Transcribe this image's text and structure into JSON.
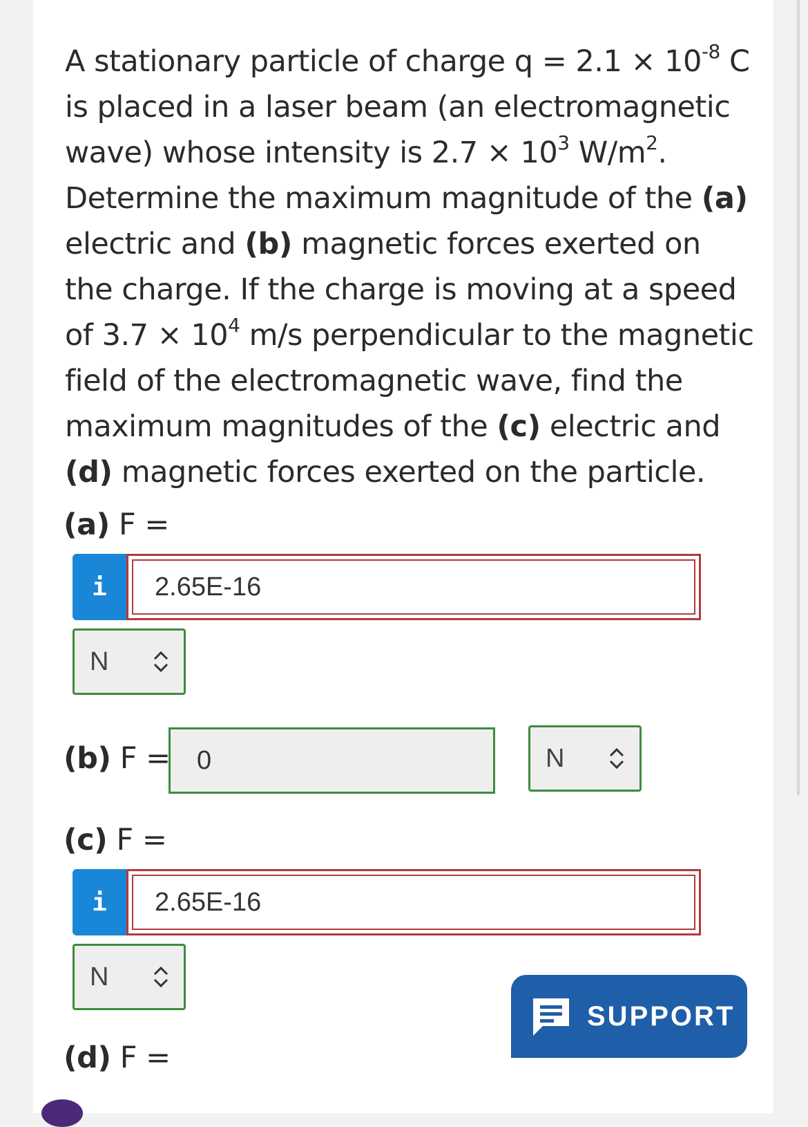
{
  "question": {
    "t1": "A stationary particle of charge q = 2.1 × 10",
    "e1": "-8",
    "t2": " C is placed in a laser beam (an electromagnetic wave) whose intensity is 2.7 × 10",
    "e2": "3",
    "t3": " W/m",
    "e3": "2",
    "t4": ". Determine the maximum magnitude of the ",
    "a": "(a)",
    "t5": " electric and ",
    "b": "(b)",
    "t6": " magnetic forces exerted on the charge. If the charge is moving at a speed of 3.7 × 10",
    "e4": "4",
    "t7": " m/s perpendicular to the magnetic field of the electromagnetic wave, find the maximum magnitudes of the ",
    "c": "(c)",
    "t8": " electric and ",
    "d": "(d)",
    "t9": " magnetic forces exerted on the particle."
  },
  "parts": {
    "a": {
      "part": "(a)",
      "label": "F =",
      "value": "2.65E-16",
      "unit": "N",
      "info": "i"
    },
    "b": {
      "part": "(b)",
      "label": "F =",
      "value": "0",
      "unit": "N"
    },
    "c": {
      "part": "(c)",
      "label": "F =",
      "value": "2.65E-16",
      "unit": "N",
      "info": "i"
    },
    "d": {
      "part": "(d)",
      "label": "F ="
    }
  },
  "support": {
    "label": "SUPPORT",
    "icon": "chat-icon"
  },
  "colors": {
    "incorrect": "#b23a3a",
    "correct": "#3f8a3f",
    "info": "#1a86d8",
    "support": "#1f5ea8"
  }
}
